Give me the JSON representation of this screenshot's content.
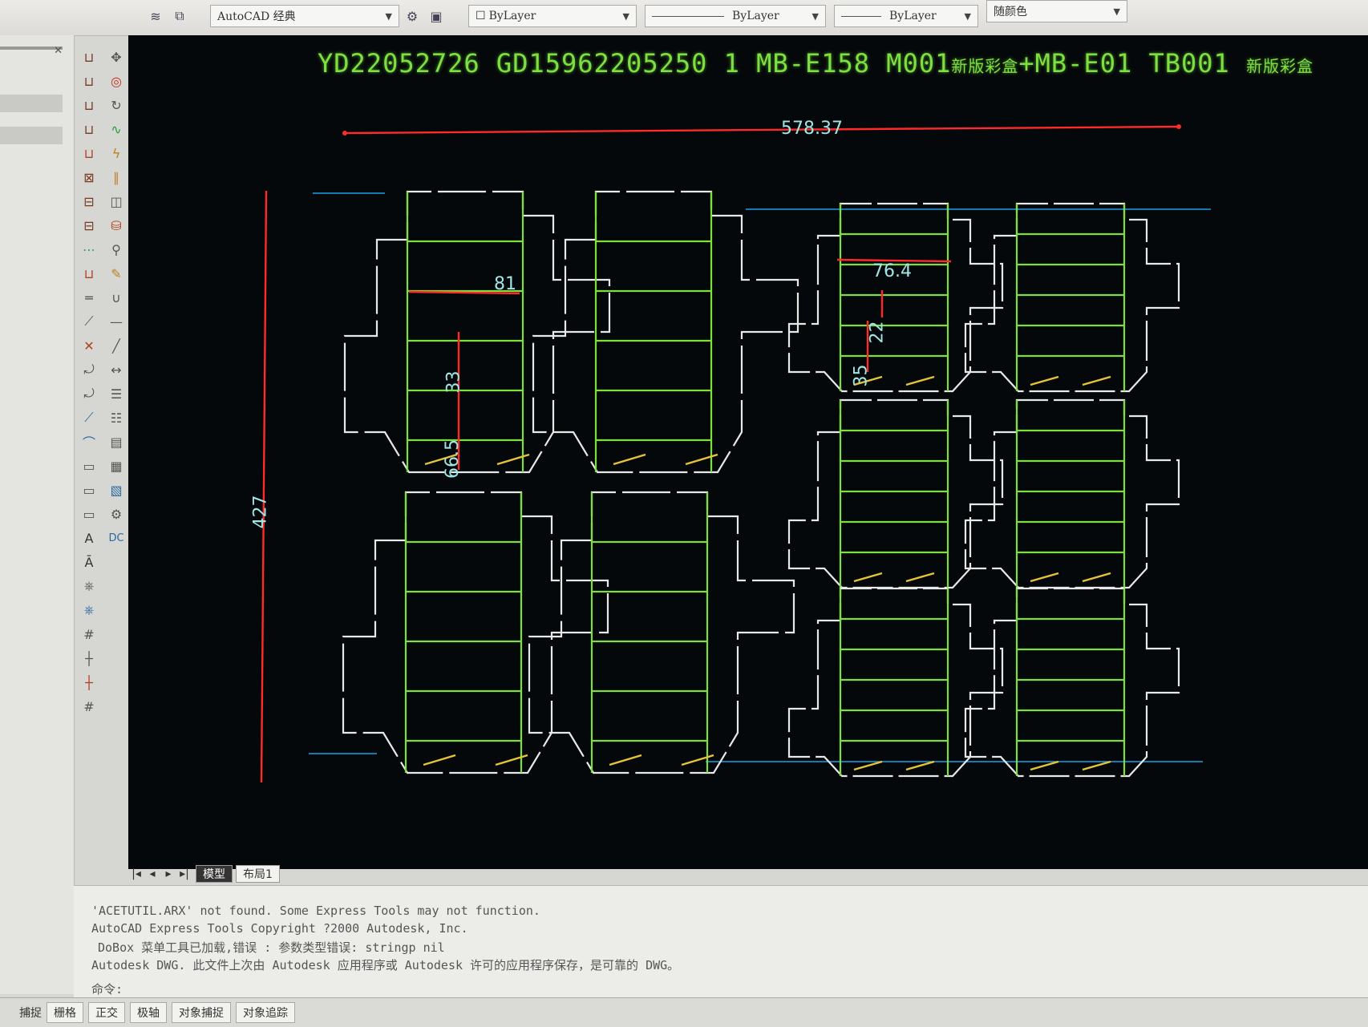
{
  "toolbar": {
    "workspace": "AutoCAD 经典",
    "layer": "ByLayer",
    "linetype": "ByLayer",
    "lineweight": "ByLayer",
    "color": "随颜色"
  },
  "drawing": {
    "header": {
      "part1": "YD22052726",
      "part2": "GD15962205250 1",
      "part3": "MB-E158",
      "part4": "M001",
      "part5": "新版彩盒",
      "part6": "+MB-E01",
      "part7": "TB001",
      "part8": "新版彩盒"
    },
    "dimensions": {
      "total_width": "578.37",
      "total_height": "427",
      "box_width": "81",
      "flap": "33",
      "panel": "66.5",
      "small_width": "76.4",
      "small_flap": "22",
      "small_panel": "35"
    },
    "colors": {
      "background": "#05080a",
      "outline": "#e8e8e8",
      "fold": "#7ee040",
      "dimension": "#ff2a2a",
      "guide": "#1aa0e6",
      "glue": "#e6c43a"
    }
  },
  "tabs": {
    "model": "模型",
    "layout": "布局1"
  },
  "command": {
    "line1": "'ACETUTIL.ARX' not found.  Some Express Tools may not function.",
    "line2": "AutoCAD Express Tools Copyright ?2000 Autodesk, Inc.",
    "line3": "DoBox 菜单工具已加载,错误 : 参数类型错误: stringp nil",
    "line4": "Autodesk DWG.   此文件上次由 Autodesk 应用程序或 Autodesk 许可的应用程序保存，是可靠的 DWG。",
    "prompt": "命令:"
  },
  "status": {
    "snap": "捕捉",
    "grid": "栅格",
    "ortho": "正交",
    "polar": "极轴",
    "osnap": "对象捕捉",
    "otrack": "对象追踪"
  }
}
